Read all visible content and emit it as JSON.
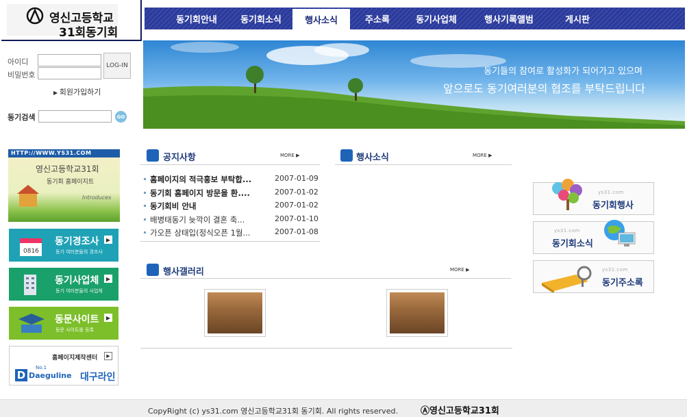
{
  "logo": {
    "line1": "영신고등학교",
    "line2": "31회동기회"
  },
  "nav": {
    "items": [
      "동기회안내",
      "동기회소식",
      "행사소식",
      "주소록",
      "동기사업체",
      "행사기록앨범",
      "게시판"
    ],
    "active_index": 2
  },
  "banner": {
    "line1": "동기들의 참여로 활성화가 되어가고 있으며",
    "line2": "앞으로도  동기여러분의 협조를 부탁드립니다"
  },
  "login": {
    "id_label": "아이디",
    "pw_label": "비밀번호",
    "login_button": "LOG-IN",
    "join_link": "회원가입하기",
    "search_label": "동기검색",
    "go_button": "GO"
  },
  "site_banner": {
    "url": "HTTP://WWW.YS31.COM",
    "line1": "영신고등학교31회",
    "line2": "동기회 홈페이지트",
    "sub": "Introduces"
  },
  "side_buttons": [
    {
      "title": "동기경조사",
      "sub": "동기 여러분들의 경조사",
      "color": "#1fa2b6"
    },
    {
      "title": "동기사업체",
      "sub": "동기 여러분들의 사업체",
      "color": "#1aa06a"
    },
    {
      "title": "동문사이트",
      "sub": "동문 사이트를 등록",
      "color": "#7cbf2a"
    }
  ],
  "make": {
    "label": "홈페이지제작센터",
    "brand_no": "No.1",
    "brand_en": "Daeguline",
    "brand_kr": "대구라인"
  },
  "notice": {
    "title": "공지사항",
    "more": "MORE",
    "rows": [
      {
        "title": "홈페이지의 적극홍보 부탁합...",
        "date": "2007-01-09",
        "bold": true
      },
      {
        "title": "동기회 홈페이지 방문을 환....",
        "date": "2007-01-02",
        "bold": true
      },
      {
        "title": "동기회비 안내",
        "date": "2007-01-02",
        "bold": true
      },
      {
        "title": "배병태동기 늦깍이 결혼 축...",
        "date": "2007-01-10",
        "bold": false
      },
      {
        "title": "가오픈 상태입(정식오픈 1월...",
        "date": "2007-01-08",
        "bold": false
      }
    ]
  },
  "events": {
    "title": "행사소식",
    "more": "MORE"
  },
  "gallery": {
    "title": "행사갤러리",
    "more": "MORE"
  },
  "right_buttons": [
    {
      "url": "ys31.com",
      "label": "동기회행사"
    },
    {
      "url": "ys31.com",
      "label": "동기회소식"
    },
    {
      "url": "ys31.com",
      "label": "동기주소록"
    }
  ],
  "footer": {
    "copyright": "CopyRight (c) ys31.com 영신고등학교31회 동기회. All rights reserved.",
    "logo": "영신고등학교31회"
  }
}
